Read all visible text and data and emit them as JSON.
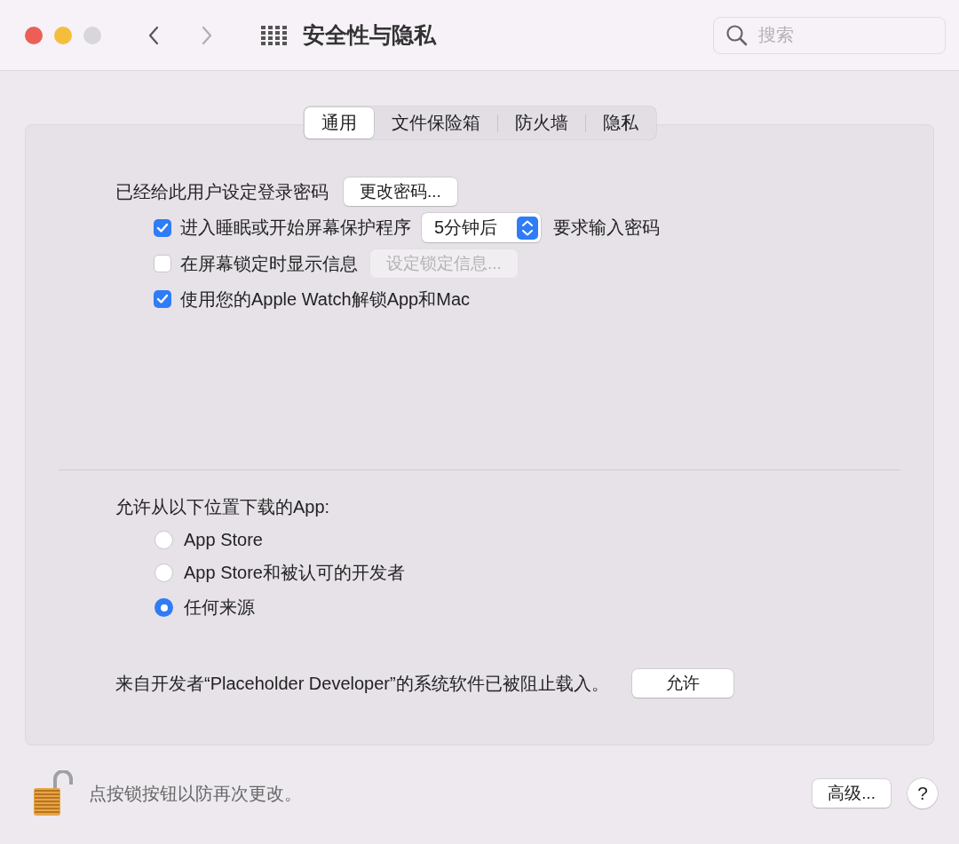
{
  "window": {
    "title": "安全性与隐私"
  },
  "nav": [
    {
      "kind": "back",
      "disabled": false
    },
    {
      "kind": "forward",
      "disabled": true
    }
  ],
  "search": {
    "placeholder": "搜索"
  },
  "tabs": [
    {
      "label": "通用",
      "selected": true
    },
    {
      "label": "文件保险箱",
      "selected": false
    },
    {
      "label": "防火墙",
      "selected": false
    },
    {
      "label": "隐私",
      "selected": false
    }
  ],
  "password": {
    "label": "已经给此用户设定登录密码",
    "button": "更改密码..."
  },
  "options": [
    {
      "kind": "select",
      "checked": true,
      "label": "进入睡眠或开始屏幕保护程序",
      "select": "5分钟后",
      "suffix": "要求输入密码"
    },
    {
      "kind": "button",
      "checked": false,
      "label": "在屏幕锁定时显示信息",
      "button": "设定锁定信息...",
      "disabled": true
    },
    {
      "kind": "plain",
      "checked": true,
      "label": "使用您的Apple Watch解锁App和Mac"
    }
  ],
  "downloads": {
    "label": "允许从以下位置下载的App:",
    "choices": [
      {
        "label": "App Store",
        "selected": false
      },
      {
        "label": "App Store和被认可的开发者",
        "selected": false
      },
      {
        "label": "任何来源",
        "selected": true
      }
    ]
  },
  "blocked": {
    "text": "来自开发者“Placeholder Developer”的系统软件已被阻止载入。",
    "button": "允许"
  },
  "footer": {
    "locked": false,
    "text": "点按锁按钮以防再次更改。",
    "advanced": "高级...",
    "help": "?"
  }
}
